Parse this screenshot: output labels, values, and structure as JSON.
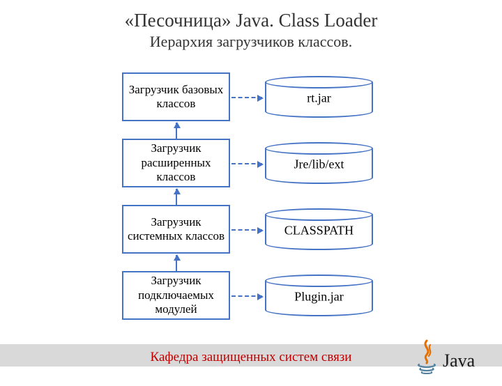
{
  "title": "«Песочница» Java. Class Loader",
  "subtitle": "Иерархия загрузчиков классов.",
  "loaders": [
    {
      "label": "Загрузчик базовых классов",
      "resource": "rt.jar"
    },
    {
      "label": "Загрузчик расширенных классов",
      "resource": "Jre/lib/ext"
    },
    {
      "label": "Загрузчик системных классов",
      "resource": "CLASSPATH"
    },
    {
      "label": "Загрузчик подключаемых модулей",
      "resource": "Plugin.jar"
    }
  ],
  "footer": "Кафедра защищенных систем связи",
  "logo_text": "Java"
}
